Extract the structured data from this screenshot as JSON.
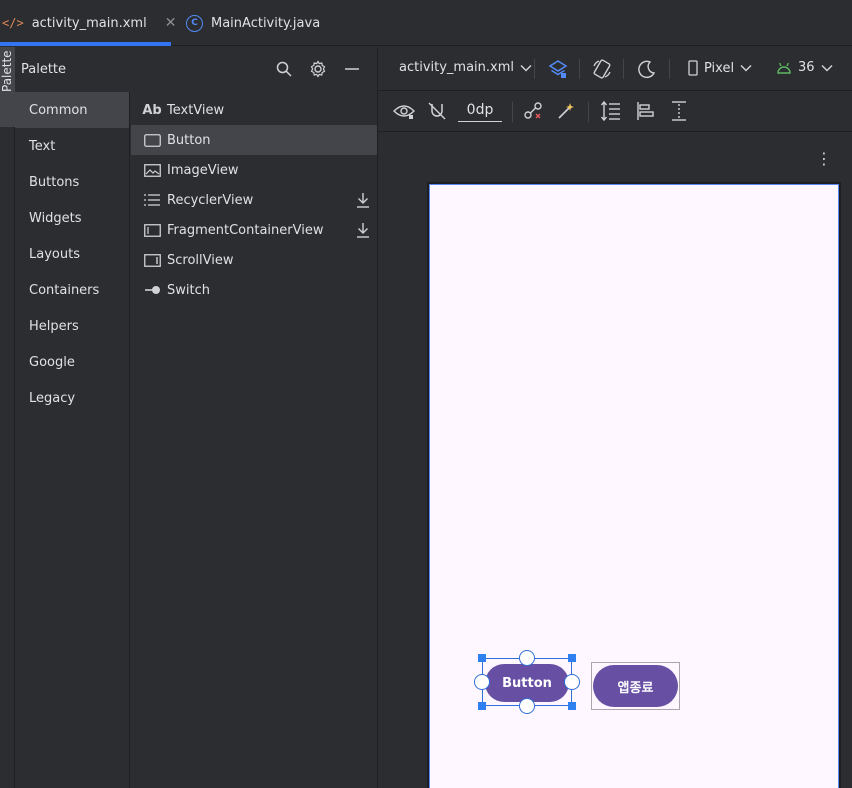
{
  "tabs": [
    {
      "label": "activity_main.xml",
      "icon": "xml-code-icon",
      "active": true
    },
    {
      "label": "MainActivity.java",
      "icon": "java-class-icon",
      "active": false
    }
  ],
  "side_stripe": {
    "label": "Palette"
  },
  "palette": {
    "title": "Palette",
    "categories": [
      "Common",
      "Text",
      "Buttons",
      "Widgets",
      "Layouts",
      "Containers",
      "Helpers",
      "Google",
      "Legacy"
    ],
    "selected_category": "Common",
    "components": [
      {
        "label": "TextView",
        "icon": "textview-icon"
      },
      {
        "label": "Button",
        "icon": "button-icon"
      },
      {
        "label": "ImageView",
        "icon": "image-icon"
      },
      {
        "label": "RecyclerView",
        "icon": "list-icon",
        "downloadable": true
      },
      {
        "label": "FragmentContainerView",
        "icon": "fragment-icon",
        "downloadable": true
      },
      {
        "label": "ScrollView",
        "icon": "scrollview-icon"
      },
      {
        "label": "Switch",
        "icon": "switch-icon"
      }
    ],
    "selected_component": "Button"
  },
  "design_toolbar": {
    "file": "activity_main.xml",
    "device": "Pixel",
    "api_level": "36",
    "default_margin": "0dp"
  },
  "layout": {
    "buttons": [
      {
        "label": "Button",
        "selected": true
      },
      {
        "label": "앱종료",
        "selected": false
      }
    ]
  },
  "colors": {
    "accent": "#3574f0",
    "button_fill": "#6750a4",
    "screen_bg": "#fef7ff"
  }
}
